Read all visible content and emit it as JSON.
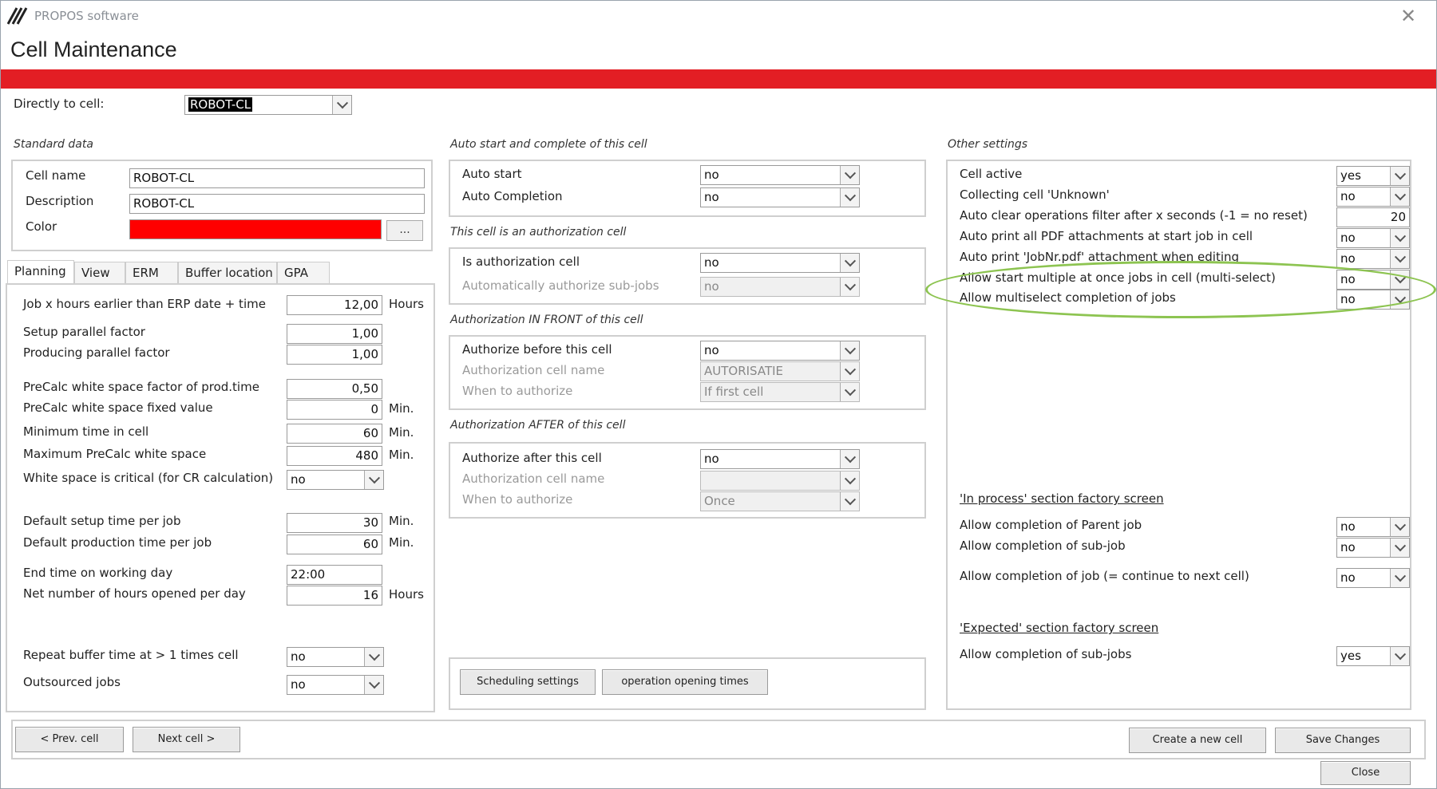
{
  "app": {
    "name": "PROPOS software",
    "close_glyph": "✕",
    "title": "Cell Maintenance",
    "accent_color": "#e31e24"
  },
  "direct": {
    "label": "Directly to cell:",
    "value": "ROBOT-CL"
  },
  "standard": {
    "title": "Standard data",
    "cell_name_label": "Cell name",
    "cell_name": "ROBOT-CL",
    "description_label": "Description",
    "description": "ROBOT-CL",
    "color_label": "Color",
    "color_value": "#ff0000",
    "color_button": "..."
  },
  "tabs": [
    "Planning",
    "View",
    "ERM",
    "Buffer location",
    "GPA"
  ],
  "planning": {
    "rows": [
      {
        "label": "Job x hours earlier than ERP date + time",
        "value": "12,00",
        "unit": "Hours"
      },
      {
        "label": "Setup parallel factor",
        "value": "1,00",
        "unit": ""
      },
      {
        "label": "Producing parallel factor",
        "value": "1,00",
        "unit": ""
      },
      {
        "label": "PreCalc white space factor of prod.time",
        "value": "0,50",
        "unit": ""
      },
      {
        "label": "PreCalc white space fixed value",
        "value": "0",
        "unit": "Min."
      },
      {
        "label": "Minimum time in cell",
        "value": "60",
        "unit": "Min."
      },
      {
        "label": "Maximum PreCalc white space",
        "value": "480",
        "unit": "Min."
      },
      {
        "label": "White space is critical (for CR calculation)",
        "value": "no",
        "unit": ""
      },
      {
        "label": "Default setup time per job",
        "value": "30",
        "unit": "Min."
      },
      {
        "label": "Default production time per job",
        "value": "60",
        "unit": "Min."
      },
      {
        "label": "End time on working day",
        "value": "22:00",
        "unit": ""
      },
      {
        "label": "Net number of hours opened per day",
        "value": "16",
        "unit": "Hours"
      },
      {
        "label": "Repeat buffer time at > 1 times cell",
        "value": "no",
        "unit": ""
      },
      {
        "label": "Outsourced jobs",
        "value": "no",
        "unit": ""
      }
    ]
  },
  "auto": {
    "title": "Auto start and complete of this cell",
    "rows": [
      {
        "label": "Auto start",
        "value": "no"
      },
      {
        "label": "Auto Completion",
        "value": "no"
      }
    ]
  },
  "authcell": {
    "title": "This cell is an authorization cell",
    "rows": [
      {
        "label": "Is authorization cell",
        "value": "no"
      },
      {
        "label": "Automatically authorize sub-jobs",
        "value": "no"
      }
    ]
  },
  "authfront": {
    "title": "Authorization IN FRONT of this cell",
    "rows": [
      {
        "label": "Authorize before this cell",
        "value": "no"
      },
      {
        "label": "Authorization cell name",
        "value": "AUTORISATIE"
      },
      {
        "label": "When to authorize",
        "value": "If first cell"
      }
    ]
  },
  "authafter": {
    "title": "Authorization AFTER of this cell",
    "rows": [
      {
        "label": "Authorize after this cell",
        "value": "no"
      },
      {
        "label": "Authorization cell name",
        "value": ""
      },
      {
        "label": "When to authorize",
        "value": "Once"
      }
    ]
  },
  "midbuttons": {
    "scheduling": "Scheduling settings",
    "opening": "operation opening times"
  },
  "other": {
    "title": "Other settings",
    "rows": [
      {
        "label": "Cell active",
        "value": "yes"
      },
      {
        "label": "Collecting cell 'Unknown'",
        "value": "no"
      },
      {
        "label": "Auto clear operations filter after x seconds (-1 = no reset)",
        "value": "20"
      },
      {
        "label": "Auto print all PDF attachments at start job in cell",
        "value": "no"
      },
      {
        "label": "Auto print 'JobNr.pdf' attachment when editing",
        "value": "no"
      },
      {
        "label": "Allow start multiple at once jobs in cell (multi-select)",
        "value": "no"
      },
      {
        "label": "Allow multiselect completion of jobs",
        "value": "no"
      }
    ],
    "highlight_color": "#8dc451"
  },
  "inprocess": {
    "title": "'In process' section factory screen",
    "rows": [
      {
        "label": "Allow completion of Parent job",
        "value": "no"
      },
      {
        "label": "Allow completion of sub-job",
        "value": "no"
      },
      {
        "label": "Allow completion of job  (= continue to next cell)",
        "value": "no"
      }
    ]
  },
  "expected": {
    "title": "'Expected' section factory screen",
    "rows": [
      {
        "label": "Allow completion of sub-jobs",
        "value": "yes"
      }
    ]
  },
  "footer": {
    "prev": "< Prev. cell",
    "next": "Next cell >",
    "create": "Create a new cell",
    "save": "Save Changes",
    "close": "Close"
  }
}
